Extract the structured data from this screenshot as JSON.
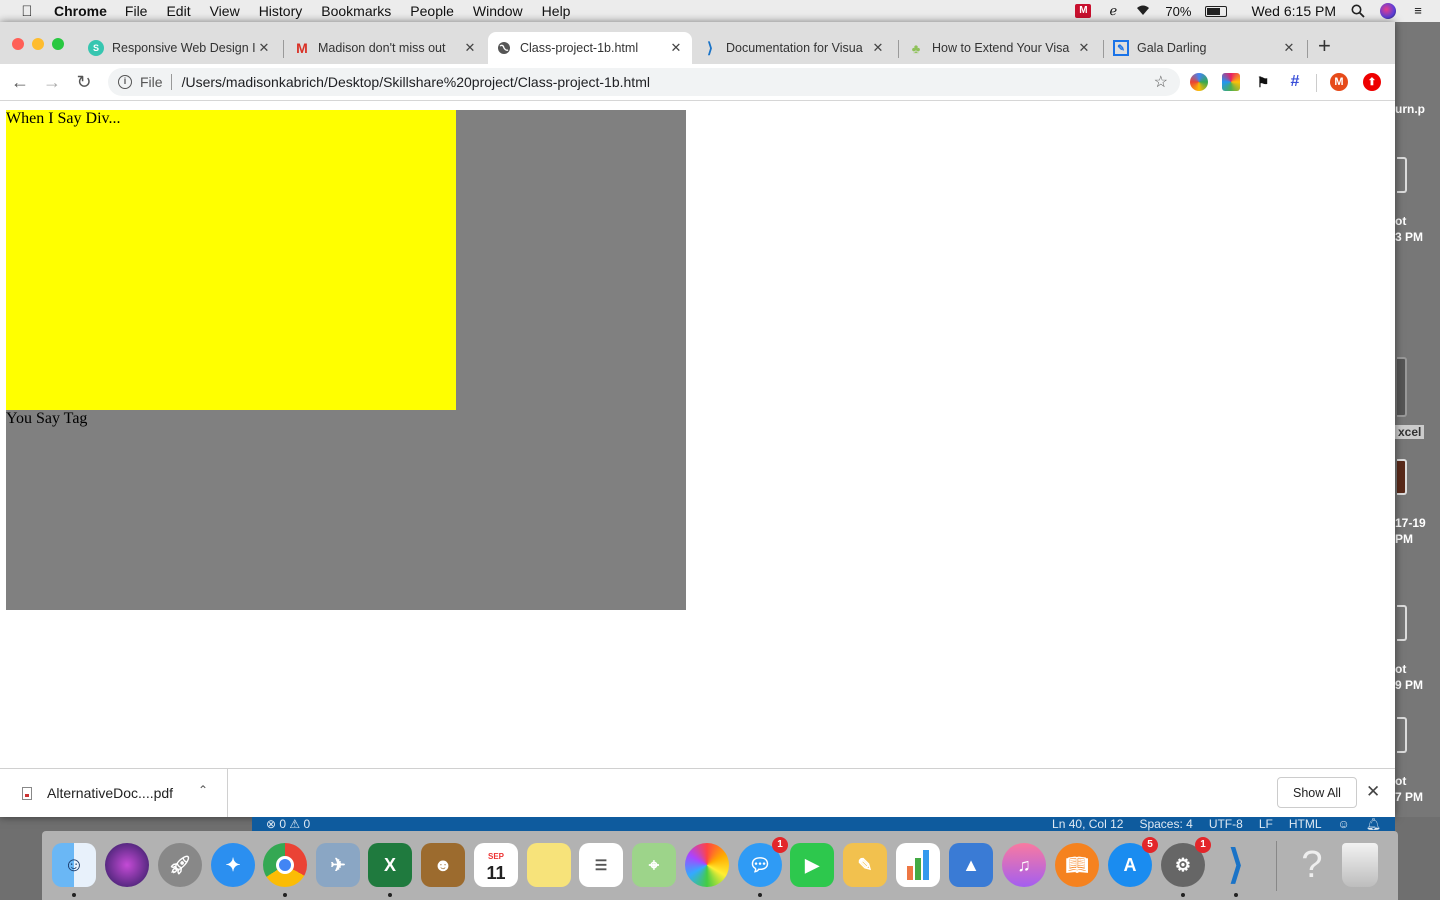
{
  "menubar": {
    "app_name": "Chrome",
    "items": [
      "File",
      "Edit",
      "View",
      "History",
      "Bookmarks",
      "People",
      "Window",
      "Help"
    ],
    "battery": "70%",
    "clock": "Wed 6:15 PM"
  },
  "tabs": [
    {
      "title": "Responsive Web Design I",
      "favicon": "skillshare-icon"
    },
    {
      "title": "Madison don't miss out",
      "favicon": "gmail-icon"
    },
    {
      "title": "Class-project-1b.html",
      "favicon": "globe-icon",
      "active": true
    },
    {
      "title": "Documentation for Visua",
      "favicon": "vscode-icon"
    },
    {
      "title": "How to Extend Your Visa",
      "favicon": "tree-icon"
    },
    {
      "title": "Gala Darling",
      "favicon": "pen-icon"
    }
  ],
  "omnibox": {
    "scheme": "File",
    "url": "/Users/madisonkabrich/Desktop/Skillshare%20project/Class-project-1b.html"
  },
  "extensions": {
    "profile_initial": "M"
  },
  "page": {
    "inner_text": "When I Say Div...",
    "outer_text": "You Say Tag",
    "colors": {
      "outer": "#808080",
      "inner": "#ffff00"
    }
  },
  "download_shelf": {
    "filename": "AlternativeDoc....pdf",
    "show_all": "Show All"
  },
  "vscode_status": {
    "problems": "⊗ 0 ⚠ 0",
    "position": "Ln 40, Col 12",
    "spaces": "Spaces: 4",
    "encoding": "UTF-8",
    "eol": "LF",
    "language": "HTML"
  },
  "desktop_labels": {
    "a": "urn.p",
    "b": "ot",
    "c": "3 PM",
    "d": "xcel",
    "e": "17-19",
    "f": "PM",
    "g": "ot",
    "h": "9 PM",
    "i": "ot",
    "j": "7 PM"
  },
  "dock": {
    "calendar_month": "SEP",
    "calendar_day": "11",
    "badges": {
      "messages": "1",
      "appstore": "5",
      "prefs": "1"
    }
  }
}
